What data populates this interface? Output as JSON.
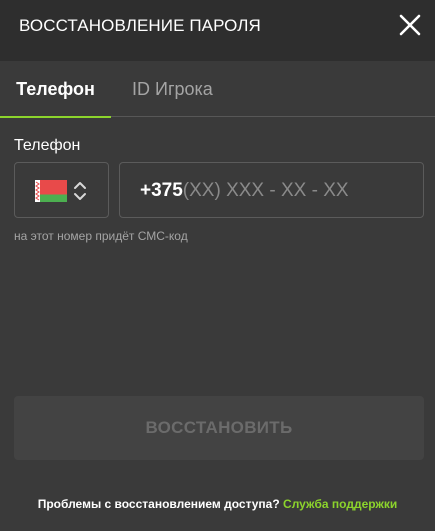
{
  "header": {
    "title": "ВОССТАНОВЛЕНИЕ ПАРОЛЯ",
    "close_icon": "close-icon"
  },
  "tabs": [
    {
      "label": "Телефон",
      "active": true
    },
    {
      "label": "ID Игрока",
      "active": false
    }
  ],
  "form": {
    "phone_label": "Телефон",
    "country": {
      "flag_icon": "belarus-flag-icon",
      "selector_icon": "chevron-up-down-icon"
    },
    "phone_prefix": "+375",
    "phone_mask": "(XX) XXX - XX - XX",
    "hint": "на этот номер придёт СМС-код"
  },
  "submit": {
    "label": "ВОССТАНОВИТЬ"
  },
  "footer": {
    "text": "Проблемы с восстановлением доступа?",
    "link": "Служба поддержки"
  },
  "colors": {
    "accent": "#8cd42c",
    "background": "#3a3a3a",
    "header_background": "#2e2e2e",
    "button_disabled": "#434343"
  }
}
